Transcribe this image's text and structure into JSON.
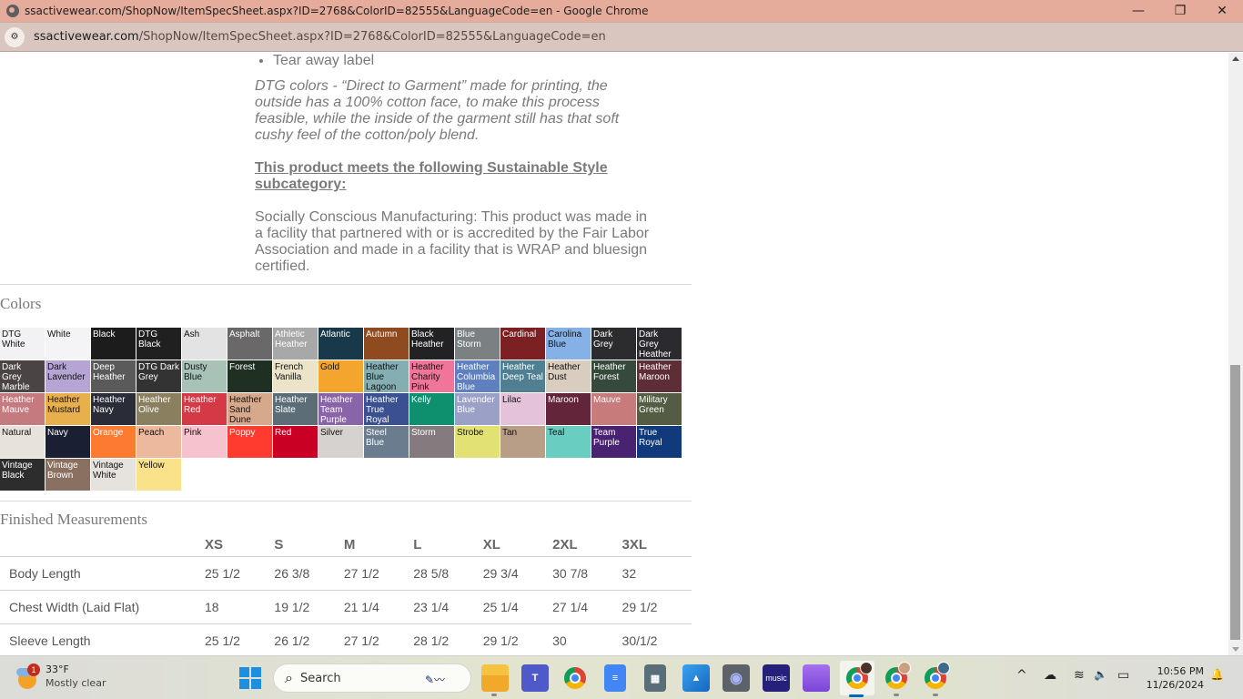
{
  "window": {
    "title": "ssactivewear.com/ShopNow/ItemSpecSheet.aspx?ID=2768&ColorID=82555&LanguageCode=en - Google Chrome",
    "minimize_icon": "minimize-icon",
    "restore_icon": "restore-icon",
    "close_icon": "close-icon",
    "minimize_glyph": "—",
    "restore_glyph": "❐",
    "close_glyph": "✕"
  },
  "address_bar": {
    "site_info_icon": "tune-icon",
    "site_info_glyph": "⚙",
    "host": "ssactivewear.com",
    "path": "/ShopNow/ItemSpecSheet.aspx?ID=2768&ColorID=82555&LanguageCode=en"
  },
  "description": {
    "bullets": [
      "Tear away label"
    ],
    "dtg_note": "DTG colors - “Direct to Garment” made for printing, the outside has a 100% cotton face, to make this process feasible, while the inside of the garment still has that soft cushy feel of the cotton/poly blend.",
    "sustainable_heading": "This product meets the following Sustainable Style subcategory:",
    "sustainable_body": "Socially Conscious Manufacturing: This product was made in a facility that partnered with or is accredited by the Fair Labor Association and made in a facility that is WRAP and bluesign certified."
  },
  "colors": {
    "title": "Colors",
    "items": [
      {
        "name": "DTG White",
        "hex": "#f2f2f4",
        "text": "dark"
      },
      {
        "name": "White",
        "hex": "#f4f4f6",
        "text": "dark"
      },
      {
        "name": "Black",
        "hex": "#1c1c1c",
        "text": "light"
      },
      {
        "name": "DTG Black",
        "hex": "#202020",
        "text": "light"
      },
      {
        "name": "Ash",
        "hex": "#e3e3e3",
        "text": "dark"
      },
      {
        "name": "Asphalt",
        "hex": "#6a6868",
        "text": "light"
      },
      {
        "name": "Athletic Heather",
        "hex": "#a8a8a8",
        "text": "light"
      },
      {
        "name": "Atlantic",
        "hex": "#17394a",
        "text": "light"
      },
      {
        "name": "Autumn",
        "hex": "#8f4a20",
        "text": "light"
      },
      {
        "name": "Black Heather",
        "hex": "#222224",
        "text": "light"
      },
      {
        "name": "Blue Storm",
        "hex": "#7b8083",
        "text": "light"
      },
      {
        "name": "Cardinal",
        "hex": "#7c2024",
        "text": "light"
      },
      {
        "name": "Carolina Blue",
        "hex": "#86b1e6",
        "text": "dark"
      },
      {
        "name": "Dark Grey",
        "hex": "#2c2c2e",
        "text": "light"
      },
      {
        "name": "Dark Grey Heather",
        "hex": "#2b2b2f",
        "text": "light"
      },
      {
        "name": "Dark Grey Marble",
        "hex": "#4a4444",
        "text": "light"
      },
      {
        "name": "Dark Lavender",
        "hex": "#b5a4d4",
        "text": "dark"
      },
      {
        "name": "Deep Heather",
        "hex": "#5a5a5a",
        "text": "light"
      },
      {
        "name": "DTG Dark Grey",
        "hex": "#333333",
        "text": "light"
      },
      {
        "name": "Dusty Blue",
        "hex": "#a8c2b8",
        "text": "dark"
      },
      {
        "name": "Forest",
        "hex": "#1f2f22",
        "text": "light"
      },
      {
        "name": "French Vanilla",
        "hex": "#ebe4c9",
        "text": "dark"
      },
      {
        "name": "Gold",
        "hex": "#f4a52e",
        "text": "dark"
      },
      {
        "name": "Heather Blue Lagoon",
        "hex": "#85aeb3",
        "text": "dark"
      },
      {
        "name": "Heather Charity Pink",
        "hex": "#f0759a",
        "text": "dark"
      },
      {
        "name": "Heather Columbia Blue",
        "hex": "#5f7fbf",
        "text": "light"
      },
      {
        "name": "Heather Deep Teal",
        "hex": "#4f7f90",
        "text": "light"
      },
      {
        "name": "Heather Dust",
        "hex": "#d9cdbf",
        "text": "dark"
      },
      {
        "name": "Heather Forest",
        "hex": "#354a3a",
        "text": "light"
      },
      {
        "name": "Heather Maroon",
        "hex": "#5e2e36",
        "text": "light"
      },
      {
        "name": "Heather Mauve",
        "hex": "#c47a7e",
        "text": "light"
      },
      {
        "name": "Heather Mustard",
        "hex": "#e8b04c",
        "text": "dark"
      },
      {
        "name": "Heather Navy",
        "hex": "#2a2d38",
        "text": "light"
      },
      {
        "name": "Heather Olive",
        "hex": "#8a8060",
        "text": "light"
      },
      {
        "name": "Heather Red",
        "hex": "#d33a46",
        "text": "light"
      },
      {
        "name": "Heather Sand Dune",
        "hex": "#d7a98c",
        "text": "dark"
      },
      {
        "name": "Heather Slate",
        "hex": "#5c6d78",
        "text": "light"
      },
      {
        "name": "Heather Team Purple",
        "hex": "#8a64a8",
        "text": "light"
      },
      {
        "name": "Heather True Royal",
        "hex": "#3a5090",
        "text": "light"
      },
      {
        "name": "Kelly",
        "hex": "#0e8f6e",
        "text": "light"
      },
      {
        "name": "Lavender Blue",
        "hex": "#9aa0c6",
        "text": "light"
      },
      {
        "name": "Lilac",
        "hex": "#e3c2da",
        "text": "dark"
      },
      {
        "name": "Maroon",
        "hex": "#62253a",
        "text": "light"
      },
      {
        "name": "Mauve",
        "hex": "#c77b7b",
        "text": "light"
      },
      {
        "name": "Military Green",
        "hex": "#545c44",
        "text": "light"
      },
      {
        "name": "Natural",
        "hex": "#e8e2dc",
        "text": "dark"
      },
      {
        "name": "Navy",
        "hex": "#1b1f33",
        "text": "light"
      },
      {
        "name": "Orange",
        "hex": "#fd7b31",
        "text": "light"
      },
      {
        "name": "Peach",
        "hex": "#ecb99f",
        "text": "dark"
      },
      {
        "name": "Pink",
        "hex": "#f6c2cd",
        "text": "dark"
      },
      {
        "name": "Poppy",
        "hex": "#fe3b2e",
        "text": "light"
      },
      {
        "name": "Red",
        "hex": "#c90023",
        "text": "light"
      },
      {
        "name": "Silver",
        "hex": "#d6d2cf",
        "text": "dark"
      },
      {
        "name": "Steel Blue",
        "hex": "#6b7c8e",
        "text": "light"
      },
      {
        "name": "Storm",
        "hex": "#857b7e",
        "text": "light"
      },
      {
        "name": "Strobe",
        "hex": "#e2e274",
        "text": "dark"
      },
      {
        "name": "Tan",
        "hex": "#b99e87",
        "text": "dark"
      },
      {
        "name": "Teal",
        "hex": "#69cdc2",
        "text": "dark"
      },
      {
        "name": "Team Purple",
        "hex": "#4a2272",
        "text": "light"
      },
      {
        "name": "True Royal",
        "hex": "#113a7c",
        "text": "light"
      },
      {
        "name": "Vintage Black",
        "hex": "#2d2d2d",
        "text": "light"
      },
      {
        "name": "Vintage Brown",
        "hex": "#8a7060",
        "text": "light"
      },
      {
        "name": "Vintage White",
        "hex": "#e6e3df",
        "text": "dark"
      },
      {
        "name": "Yellow",
        "hex": "#f9e28a",
        "text": "dark"
      }
    ]
  },
  "measurements": {
    "title": "Finished Measurements",
    "sizes": [
      "XS",
      "S",
      "M",
      "L",
      "XL",
      "2XL",
      "3XL"
    ],
    "rows": [
      {
        "label": "Body Length",
        "values": [
          "25 1/2",
          "26 3/8",
          "27 1/2",
          "28 5/8",
          "29 3/4",
          "30 7/8",
          "32"
        ]
      },
      {
        "label": "Chest Width (Laid Flat)",
        "values": [
          "18",
          "19 1/2",
          "21 1/4",
          "23 1/4",
          "25 1/4",
          "27 1/4",
          "29 1/2"
        ]
      },
      {
        "label": "Sleeve Length",
        "values": [
          "25 1/2",
          "26 1/2",
          "27 1/2",
          "28 1/2",
          "29 1/2",
          "30",
          "30/1/2"
        ]
      }
    ]
  },
  "taskbar": {
    "weather": {
      "temp": "33°F",
      "condition": "Mostly clear",
      "badge": "1"
    },
    "search_label": "Search",
    "search_glyph": "⌕",
    "apps": [
      {
        "name": "file-explorer",
        "label": ""
      },
      {
        "name": "teams",
        "label": "T"
      },
      {
        "name": "chrome",
        "label": ""
      },
      {
        "name": "google-docs",
        "label": "≡"
      },
      {
        "name": "calculator",
        "label": "▦"
      },
      {
        "name": "photos",
        "label": "▲"
      },
      {
        "name": "camera",
        "label": "◉"
      },
      {
        "name": "amazon-music",
        "label": "music"
      },
      {
        "name": "clipchamp",
        "label": ""
      },
      {
        "name": "chrome-profile-1",
        "label": ""
      },
      {
        "name": "chrome-profile-2",
        "label": ""
      },
      {
        "name": "chrome-profile-3",
        "label": ""
      }
    ],
    "tray": {
      "chevron": "^",
      "onedrive": "☁",
      "wifi": "≋",
      "volume": "🔈",
      "battery": "▭",
      "bell": "🔔"
    },
    "time": "10:56 PM",
    "date": "11/26/2024"
  }
}
